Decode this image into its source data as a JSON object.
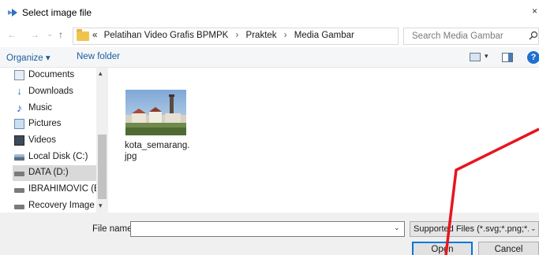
{
  "titlebar": {
    "title": "Select image file",
    "close": "×"
  },
  "nav": {
    "back": "←",
    "forward": "→",
    "recent": "⌄",
    "up": "↑",
    "overflow": "«",
    "breadcrumbs": [
      "Pelatihan Video Grafis BPMPK",
      "Praktek",
      "Media Gambar"
    ],
    "separator": "›",
    "dropdown": "⌄",
    "refresh": "↻",
    "search_placeholder": "Search Media Gambar",
    "search_glyph": "⌕"
  },
  "toolbar": {
    "organize": "Organize ▾",
    "new_folder": "New folder",
    "view_dropdown": "▾",
    "help": "?"
  },
  "sidebar": {
    "items": [
      {
        "label": "Documents",
        "icon": "documents-icon"
      },
      {
        "label": "Downloads",
        "icon": "downloads-icon"
      },
      {
        "label": "Music",
        "icon": "music-icon"
      },
      {
        "label": "Pictures",
        "icon": "pictures-icon"
      },
      {
        "label": "Videos",
        "icon": "videos-icon"
      },
      {
        "label": "Local Disk (C:)",
        "icon": "local-disk-icon"
      },
      {
        "label": "DATA (D:)",
        "icon": "drive-icon",
        "selected": true
      },
      {
        "label": "IBRAHIMOVIC (E",
        "icon": "drive-icon"
      },
      {
        "label": "Recovery Image",
        "icon": "drive-icon"
      }
    ],
    "scroll_up": "▴",
    "scroll_down": "▾"
  },
  "files": [
    {
      "name": "kota_semarang.jpg",
      "icon": "image-thumbnail"
    }
  ],
  "bottom": {
    "file_name_label": "File name:",
    "file_name_value": "",
    "dropdown": "⌄",
    "filter": "Supported Files (*.svg;*.png;*.jp",
    "open": "Open",
    "cancel": "Cancel"
  },
  "colors": {
    "link": "#1a5c9e",
    "annotation": "#e8141e",
    "selected": "#d9d9d9",
    "focus": "#0078d7"
  }
}
